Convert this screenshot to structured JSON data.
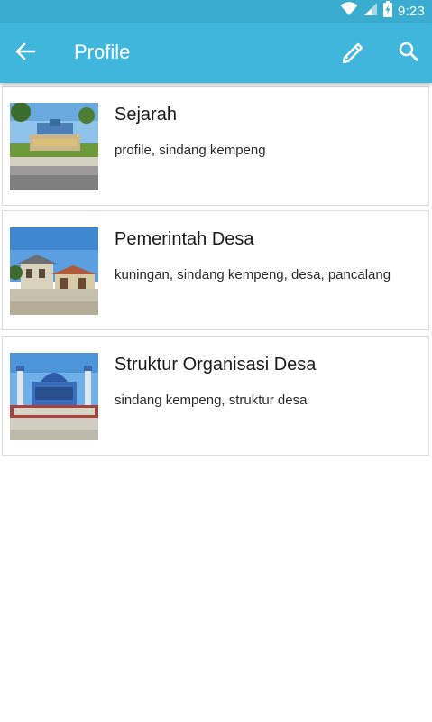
{
  "status_bar": {
    "time": "9:23",
    "icons": [
      "wifi-icon",
      "signal-icon",
      "battery-charging-icon"
    ]
  },
  "app_bar": {
    "title": "Profile",
    "back_icon": "arrow-left-icon",
    "edit_icon": "pencil-icon",
    "search_icon": "search-icon"
  },
  "posts": [
    {
      "title": "Sejarah",
      "tags": "profile, sindang kempeng",
      "thumbnail": "village-gate-photo"
    },
    {
      "title": "Pemerintah Desa",
      "tags": "kuningan, sindang kempeng, desa, pancalang",
      "thumbnail": "village-hall-photo"
    },
    {
      "title": "Struktur Organisasi Desa",
      "tags": "sindang kempeng, struktur desa",
      "thumbnail": "mosque-photo"
    }
  ],
  "colors": {
    "status_bar": "#3aaccf",
    "app_bar": "#41b6dc",
    "background": "#ffffff",
    "card_border": "#dcdcdc"
  }
}
